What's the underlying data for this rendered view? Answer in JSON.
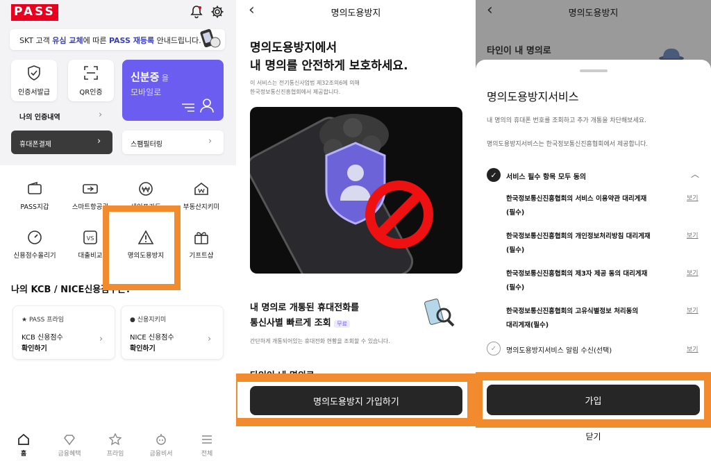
{
  "home": {
    "logo": "PASS",
    "banner": {
      "p1": "SKT 고객 ",
      "p2": "유심 교체",
      "p3": "에 따른 ",
      "p4": "PASS 재등록",
      "p5": " 안내드립니다."
    },
    "quick": [
      {
        "label": "인증서발급",
        "icon": "shield-check-icon"
      },
      {
        "label": "QR인증",
        "icon": "qr-scan-icon"
      }
    ],
    "id_card": {
      "title": "신분증",
      "suffix": " 을",
      "sub": "모바일로"
    },
    "my_auth": "나의 인증내역",
    "mobile_pay": "휴대폰결제",
    "spam_filter": "스팸필터링",
    "menu": [
      {
        "label": "PASS지갑",
        "icon": "wallet-icon"
      },
      {
        "label": "스마트항공권",
        "icon": "ticket-icon"
      },
      {
        "label": "세이프가드",
        "icon": "won-shield-icon"
      },
      {
        "label": "부동산지키미",
        "icon": "house-icon"
      },
      {
        "label": "신용점수올리기",
        "icon": "gauge-icon"
      },
      {
        "label": "대출비교",
        "icon": "vs-icon"
      },
      {
        "label": "명의도용방지",
        "icon": "warning-icon"
      },
      {
        "label": "기프트샵",
        "icon": "gift-icon"
      }
    ],
    "credit_title": "나의 KCB / NICE신용점수는?",
    "credit_cards": [
      {
        "tag": "PASS 프라임",
        "line1": "KCB 신용점수",
        "line2": "확인하기"
      },
      {
        "tag": "신용지키미",
        "line1": "NICE 신용점수",
        "line2": "확인하기"
      }
    ],
    "tabs": [
      "홈",
      "금융혜택",
      "프라임",
      "금융비서",
      "전체"
    ]
  },
  "intro": {
    "title": "명의도용방지",
    "headline1": "명의도용방지에서",
    "headline2": "내 명의를 안전하게 보호하세요.",
    "legal1": "이 서비스는 전기통신사업법 제32조의6에 의해",
    "legal2": "한국정보통신진흥협회에서 제공합니다.",
    "feature1": "내 명의로 개통된 휴대전화를",
    "feature2": "통신사별 빠르게 조회",
    "free_badge": "무료",
    "feature_desc": "간단하게 개통되어있는 휴대전화 현황을 조회할 수 있습니다.",
    "peek": "타인이 내 명의로",
    "cta": "명의도용방지 가입하기"
  },
  "signup": {
    "title": "명의도용방지",
    "behind": "타인이 내 명의로",
    "sheet_title": "명의도용방지서비스",
    "desc1": "내 명의의 휴대폰 번호를 조회하고 추가 개통을 차단해보세요.",
    "desc2": "명의도용방지서비스는 한국정보통신진흥협회에서 제공합니다.",
    "agree_all": "서비스 필수 항목 모두 동의",
    "terms": [
      {
        "l1": "한국정보통신진흥협회의 서비스 이용약관 대리게재",
        "l2": "(필수)"
      },
      {
        "l1": "한국정보통신진흥협회의 개인정보처리방침 대리게재",
        "l2": "(필수)"
      },
      {
        "l1": "한국정보통신진흥협회의 제3자 제공 동의 대리게재",
        "l2": "(필수)"
      },
      {
        "l1": "한국정보통신진흥협회의 고유식별정보 처리동의",
        "l2": "대리게재(필수)"
      }
    ],
    "optional": "명의도용방지서비스 알림 수신(선택)",
    "view": "보기",
    "join": "가입",
    "close": "닫기"
  },
  "colors": {
    "brand": "#e8001e",
    "accent_purple": "#6a5df0",
    "highlight": "#f28a2e",
    "link_blue": "#3b3fb6"
  }
}
